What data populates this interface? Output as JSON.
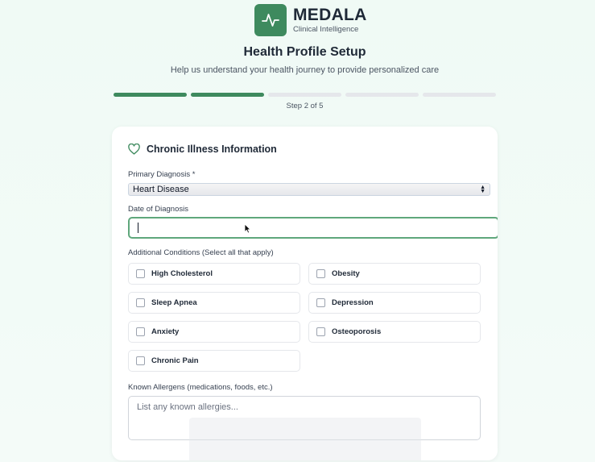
{
  "brand": {
    "name": "MEDALA",
    "tagline": "Clinical Intelligence",
    "color": "#3e8a5e"
  },
  "header": {
    "title": "Health Profile Setup",
    "subtitle": "Help us understand your health journey to provide personalized care"
  },
  "progress": {
    "current_step": 2,
    "total_steps": 5,
    "label": "Step 2 of 5"
  },
  "section": {
    "title": "Chronic Illness Information",
    "icon": "heart-icon"
  },
  "form": {
    "primary_diagnosis": {
      "label": "Primary Diagnosis *",
      "value": "Heart Disease"
    },
    "date_of_diagnosis": {
      "label": "Date of Diagnosis",
      "value": ""
    },
    "additional_conditions": {
      "label": "Additional Conditions (Select all that apply)",
      "options": [
        "High Cholesterol",
        "Obesity",
        "Sleep Apnea",
        "Depression",
        "Anxiety",
        "Osteoporosis",
        "Chronic Pain"
      ]
    },
    "known_allergens": {
      "label": "Known Allergens (medications, foods, etc.)",
      "placeholder": "List any known allergies..."
    }
  }
}
